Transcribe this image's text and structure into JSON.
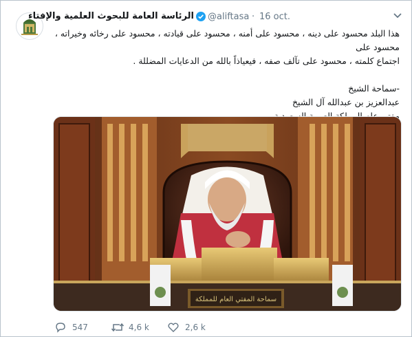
{
  "colors": {
    "verified": "#1da1f2",
    "muted": "#657786",
    "text": "#14171a"
  },
  "tweet": {
    "author_name": "الرئاسة العامة للبحوث العلمية والإفتاء",
    "handle": "@aliftasa",
    "separator": "·",
    "date": "16 oct.",
    "lines": [
      "هذا البلد محسود على دينه ، محسود على أمنه ، محسود على قيادته ، محسود على رخائه وخيراته ، محسود على",
      "اجتماع كلمته ، محسود على تآلف صفه ، فيعياذاً بالله من الدعايات المضللة ."
    ],
    "signature": [
      "-سماحة الشيخ",
      "عبدالعزيز بن عبدالله آل الشيخ",
      "مفتي عام المملكة العربية السعودية"
    ],
    "image_texts": {
      "nameplate_left": "سماحة المفتي العام للمملكة"
    }
  },
  "actions": [
    {
      "icon": "reply-icon",
      "count": "547"
    },
    {
      "icon": "retweet-icon",
      "count": "4,6 k"
    },
    {
      "icon": "like-icon",
      "count": "2,6 k"
    }
  ]
}
